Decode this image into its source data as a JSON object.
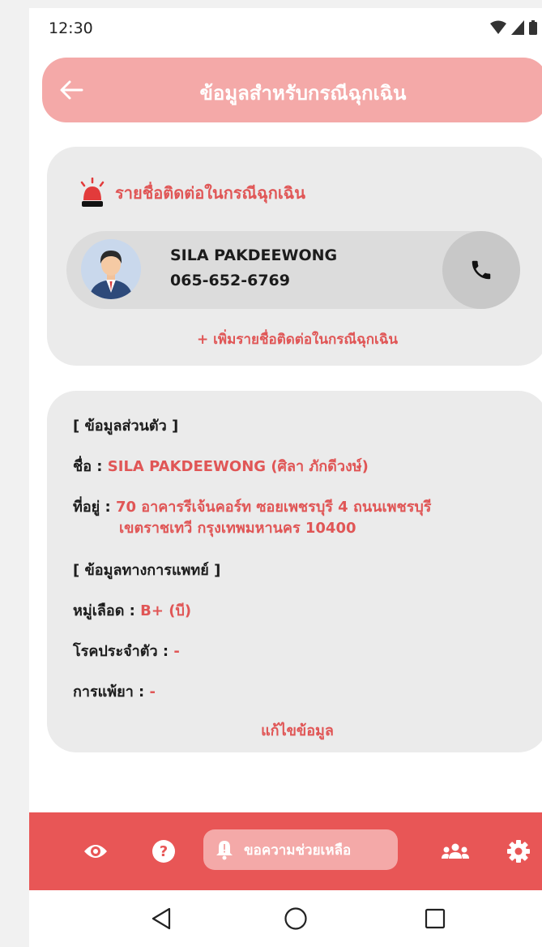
{
  "status_bar": {
    "time": "12:30"
  },
  "header": {
    "title": "ข้อมูลสำหรับกรณีฉุกเฉิน"
  },
  "contacts": {
    "heading": "รายชื่อติดต่อในกรณีฉุกเฉิน",
    "items": [
      {
        "name": "SILA PAKDEEWONG",
        "phone": "065-652-6769"
      }
    ],
    "add_label": "+ เพิ่มรายชื่อติดต่อในกรณีฉุกเฉิน"
  },
  "personal": {
    "section_label": "[ ข้อมูลส่วนตัว ]",
    "name_label": "ชื่อ :",
    "name_value": "SILA PAKDEEWONG (ศิลา ภักดีวงษ์)",
    "address_label": "ที่อยู่ :",
    "address_line1": "70 อาคารรีเจ้นคอร์ท ซอยเพชรบุรี 4 ถนนเพชรบุรี",
    "address_line2": "เขตราชเทวี กรุงเทพมหานคร 10400"
  },
  "medical": {
    "section_label": "[ ข้อมูลทางการแพทย์ ]",
    "blood_label": "หมู่เลือด :",
    "blood_value": "B+ (บี)",
    "disease_label": "โรคประจำตัว :",
    "disease_value": "-",
    "allergy_label": "การแพ้ยา :",
    "allergy_value": "-"
  },
  "edit_label": "แก้ไขข้อมูล",
  "bottom_nav": {
    "help_label": "ขอความช่วยเหลือ"
  },
  "colors": {
    "accent": "#e85656",
    "accent_light": "#f4a9a8",
    "text_red": "#e05656",
    "card_bg": "#ebebeb"
  },
  "icons": [
    "back-arrow-icon",
    "siren-icon",
    "avatar",
    "phone-icon",
    "eye-icon",
    "help-circle-icon",
    "bell-alert-icon",
    "people-icon",
    "gear-icon",
    "triangle-back-icon",
    "circle-home-icon",
    "square-recents-icon"
  ]
}
